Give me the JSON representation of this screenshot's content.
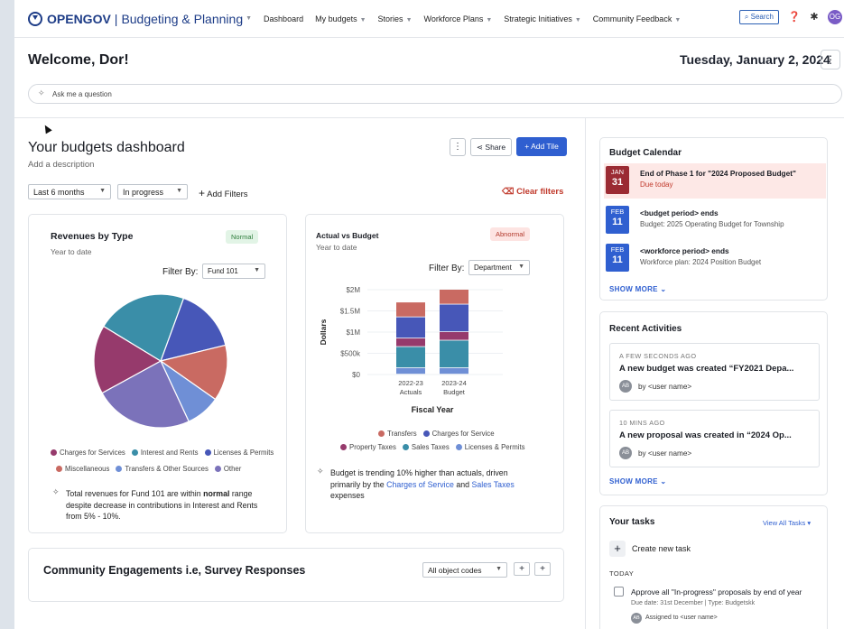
{
  "nav": {
    "brand": "OPENGOV",
    "product": "Budgeting & Planning",
    "items": [
      "Dashboard",
      "My budgets",
      "Stories",
      "Workforce Plans",
      "Strategic Initiatives",
      "Community Feedback"
    ],
    "search_label": "Search",
    "avatar_initials": "OG"
  },
  "header": {
    "welcome": "Welcome, Dor!",
    "date": "Tuesday, January 2, 2024",
    "ask_placeholder": "Ask me a question"
  },
  "dashboard": {
    "title": "Your budgets dashboard",
    "description": "Add a description",
    "share_label": "Share",
    "add_tile_label": "Add Tile",
    "filters": {
      "period": "Last 6 months",
      "status": "In progress",
      "add_filters_label": "Add Filters",
      "clear_filters_label": "Clear filters"
    }
  },
  "revenues_card": {
    "title": "Revenues by Type",
    "badge": "Normal",
    "subtitle": "Year to date",
    "filter_label": "Filter By:",
    "filter_value": "Fund 101",
    "legend": [
      "Charges for Services",
      "Interest and Rents",
      "Licenses & Permits",
      "Miscellaneous",
      "Transfers & Other Sources",
      "Other"
    ],
    "insight_prefix": "Total revenues for Fund 101 are within ",
    "insight_bold": "normal",
    "insight_suffix": " range despite decrease in contributions in Interest and Rents from 5% - 10%."
  },
  "actual_card": {
    "title": "Actual vs Budget",
    "badge": "Abnormal",
    "subtitle": "Year to date",
    "filter_label": "Filter By:",
    "filter_value": "Department",
    "legend_row1": [
      "Transfers",
      "Charges for Service"
    ],
    "legend_row2": [
      "Property Taxes",
      "Sales Taxes",
      "Licenses & Permits"
    ],
    "insight_prefix": "Budget is trending 10% higher than actuals, driven primarily by the ",
    "insight_link1": "Charges of Service",
    "insight_and": " and ",
    "insight_link2": "Sales Taxes",
    "insight_suffix": " expenses"
  },
  "community": {
    "title": "Community Engagements i.e, Survey Responses",
    "select_value": "All object codes"
  },
  "calendar": {
    "title": "Budget Calendar",
    "items": [
      {
        "month": "JAN",
        "day": "31",
        "title": "End of Phase 1 for \"2024 Proposed Budget\"",
        "sub": "Due today"
      },
      {
        "month": "FEB",
        "day": "11",
        "title": "<budget period> ends",
        "sub": "Budget: 2025 Operating Budget for Township"
      },
      {
        "month": "FEB",
        "day": "11",
        "title": "<workforce period> ends",
        "sub": "Workforce plan: 2024 Position Budget"
      }
    ],
    "show_more": "SHOW MORE"
  },
  "activities": {
    "title": "Recent Activities",
    "items": [
      {
        "when": "A FEW SECONDS AGO",
        "what": "A new budget was created “FY2021 Depa...",
        "initials": "AB",
        "by": "by <user name>"
      },
      {
        "when": "10 MINS AGO",
        "what": "A new proposal was created in  “2024 Op...",
        "initials": "AB",
        "by": "by <user name>"
      }
    ],
    "show_more": "SHOW MORE"
  },
  "tasks": {
    "title": "Your tasks",
    "view_all": "View All Tasks",
    "create_label": "Create new task",
    "section": "TODAY",
    "task_title": "Approve all \"In-progress\" proposals by end of year",
    "task_meta": "Due date: 31st December | Type: Budgetskk",
    "task_initials": "AB",
    "task_assigned": "Assigned to <user name>"
  },
  "colors": {
    "accent": "#2f5fd0",
    "brand": "#1d3c87",
    "danger": "#c0392b"
  },
  "chart_data": [
    {
      "type": "pie",
      "title": "Revenues by Type",
      "labels": [
        "Licenses & Permits",
        "Miscellaneous",
        "Transfers & Other Sources",
        "Other",
        "Charges for Services",
        "Interest and Rents"
      ],
      "values": [
        15,
        13,
        8,
        23,
        16,
        21
      ],
      "colors": [
        "#4757b8",
        "#c96a62",
        "#6f8fd6",
        "#7b72ba",
        "#963a6c",
        "#3a8ea8"
      ]
    },
    {
      "type": "bar",
      "stacked": true,
      "title": "Actual vs Budget",
      "xlabel": "Fiscal Year",
      "ylabel": "Dollars",
      "categories": [
        "2022-23\nActuals",
        "2023-24\nBudget"
      ],
      "yticks": [
        "$0",
        "$500k",
        "$1M",
        "$1.5M",
        "$2M"
      ],
      "ylim": [
        0,
        2000000
      ],
      "series": [
        {
          "name": "Licenses & Permits",
          "color": "#6f8fd6",
          "values": [
            150000,
            150000
          ]
        },
        {
          "name": "Sales Taxes",
          "color": "#3a8ea8",
          "values": [
            500000,
            650000
          ]
        },
        {
          "name": "Property Taxes",
          "color": "#963a6c",
          "values": [
            200000,
            200000
          ]
        },
        {
          "name": "Charges for Service",
          "color": "#4757b8",
          "values": [
            500000,
            650000
          ]
        },
        {
          "name": "Transfers",
          "color": "#c96a62",
          "values": [
            350000,
            350000
          ]
        }
      ]
    }
  ]
}
